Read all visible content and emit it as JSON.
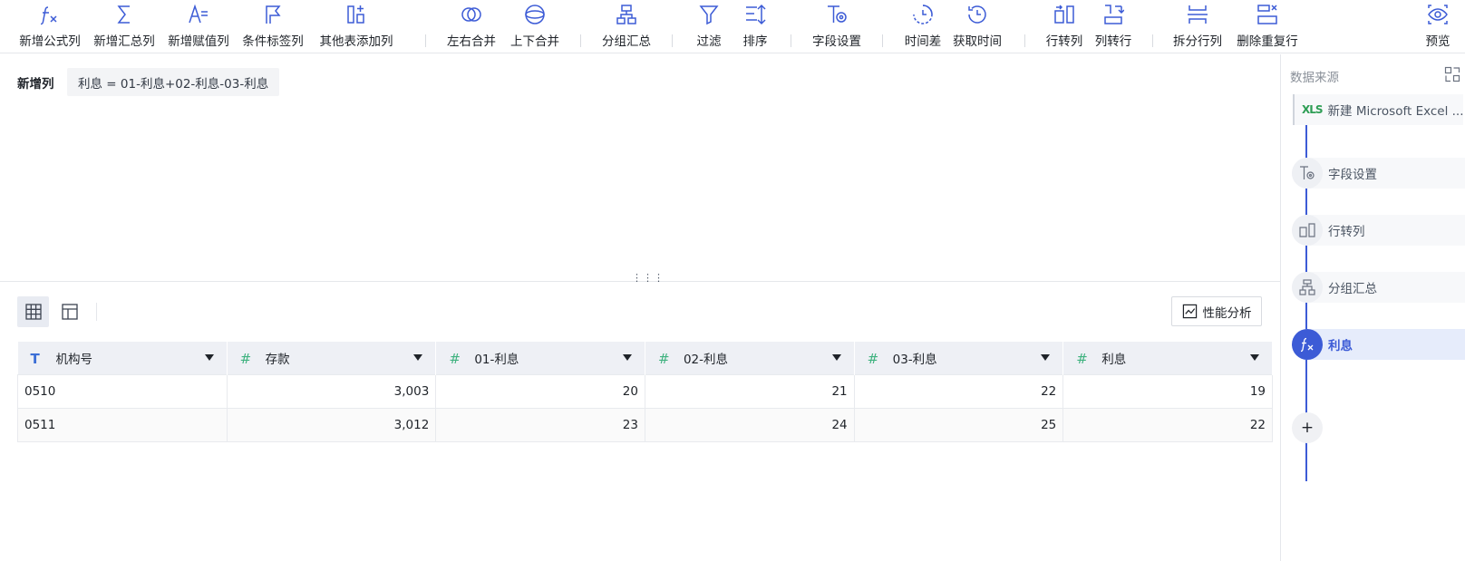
{
  "toolbar": {
    "tools": [
      {
        "label": "新增公式列",
        "icon": "fx-icon"
      },
      {
        "label": "新增汇总列",
        "icon": "sigma-icon"
      },
      {
        "label": "新增赋值列",
        "icon": "assign-value-icon"
      },
      {
        "label": "条件标签列",
        "icon": "flag-icon"
      },
      {
        "label": "其他表添加列",
        "icon": "add-column-icon"
      },
      {
        "label": "左右合并",
        "icon": "merge-horizontal-icon"
      },
      {
        "label": "上下合并",
        "icon": "merge-vertical-icon"
      },
      {
        "label": "分组汇总",
        "icon": "group-summary-icon"
      },
      {
        "label": "过滤",
        "icon": "filter-icon"
      },
      {
        "label": "排序",
        "icon": "sort-icon"
      },
      {
        "label": "字段设置",
        "icon": "field-settings-icon"
      },
      {
        "label": "时间差",
        "icon": "time-diff-icon"
      },
      {
        "label": "获取时间",
        "icon": "get-time-icon"
      },
      {
        "label": "行转列",
        "icon": "row-to-column-icon"
      },
      {
        "label": "列转行",
        "icon": "column-to-row-icon"
      },
      {
        "label": "拆分行列",
        "icon": "split-icon"
      },
      {
        "label": "删除重复行",
        "icon": "remove-duplicates-icon"
      },
      {
        "label": "预览",
        "icon": "eye-icon"
      }
    ]
  },
  "formula": {
    "title": "新增列",
    "expression": "利息 = 01-利息+02-利息-03-利息"
  },
  "grid": {
    "perf_label": "性能分析",
    "columns": [
      {
        "name": "机构号",
        "type": "text"
      },
      {
        "name": "存款",
        "type": "number"
      },
      {
        "name": "01-利息",
        "type": "number"
      },
      {
        "name": "02-利息",
        "type": "number"
      },
      {
        "name": "03-利息",
        "type": "number"
      },
      {
        "name": "利息",
        "type": "number"
      }
    ],
    "rows": [
      [
        "0510",
        "3,003",
        "20",
        "21",
        "22",
        "19"
      ],
      [
        "0511",
        "3,012",
        "23",
        "24",
        "25",
        "22"
      ]
    ]
  },
  "panel": {
    "title": "数据来源",
    "source": {
      "label": "新建 Microsoft Excel ...",
      "icon_text": "XLS"
    },
    "steps": [
      {
        "label": "字段设置",
        "icon": "field-settings-icon"
      },
      {
        "label": "行转列",
        "icon": "row-to-column-icon"
      },
      {
        "label": "分组汇总",
        "icon": "group-summary-icon"
      },
      {
        "label": "利息",
        "icon": "fx-icon",
        "active": true
      }
    ],
    "add_symbol": "+"
  },
  "colors": {
    "accent": "#3c5bd6",
    "number_type": "#3fb27f",
    "text_type": "#3c6fd6",
    "excel": "#2e9e55"
  }
}
